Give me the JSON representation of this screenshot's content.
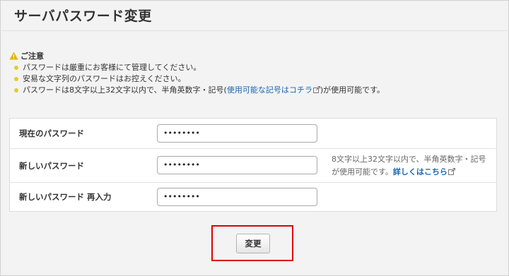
{
  "page": {
    "title": "サーバパスワード変更"
  },
  "notice": {
    "heading": "ご注意",
    "items": [
      {
        "text": "パスワードは厳重にお客様にて管理してください。"
      },
      {
        "text": "安易な文字列のパスワードはお控えください。"
      },
      {
        "text_before": "パスワードは8文字以上32文字以内で、半角英数字・記号(",
        "link": "使用可能な記号はコチラ",
        "text_after": ")が使用可能です。"
      }
    ]
  },
  "form": {
    "rows": [
      {
        "label": "現在のパスワード",
        "value": "••••••••"
      },
      {
        "label": "新しいパスワード",
        "value": "••••••••"
      },
      {
        "label": "新しいパスワード 再入力",
        "value": "••••••••"
      }
    ],
    "hint": {
      "text": "8文字以上32文字以内で、半角英数字・記号が使用可能です。",
      "link": "詳しくはこちら"
    }
  },
  "actions": {
    "submit_label": "変更"
  },
  "colors": {
    "link": "#1b67b3",
    "bullet": "#e3cc2a",
    "warning": "#e3b400",
    "highlight": "#e00000"
  }
}
